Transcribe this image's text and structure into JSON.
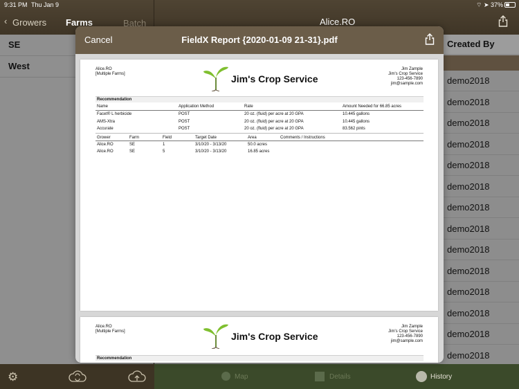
{
  "status": {
    "time": "9:31 PM",
    "date": "Thu Jan 9",
    "battery": "37%"
  },
  "left_nav": {
    "back": "Growers",
    "title": "Farms",
    "batch": "Batch"
  },
  "right_nav": {
    "title": "Alice.RO"
  },
  "left_list": [
    "SE",
    "West"
  ],
  "right_column": {
    "header": "Created By",
    "values": [
      "demo2018",
      "demo2018",
      "demo2018",
      "demo2018",
      "demo2018",
      "demo2018",
      "demo2018",
      "demo2018",
      "demo2018",
      "demo2018",
      "demo2018",
      "demo2018",
      "demo2018",
      "demo2018"
    ]
  },
  "bottom_tabs": {
    "map": "Map",
    "details": "Details",
    "history": "History"
  },
  "modal": {
    "cancel": "Cancel",
    "title": "FieldX Report {2020-01-09 21-31}.pdf"
  },
  "report": {
    "grower": "Alice.RO",
    "farms": "[Multiple Farms]",
    "brand": "Jim's Crop Service",
    "contact": [
      "Jim Zample",
      "Jim's Crop Service",
      "123-456-7890",
      "jim@sample.com"
    ],
    "recommendation_title": "Recommendation",
    "rec_headers": [
      "Name",
      "Application Method",
      "Rate",
      "Amount Needed for 66.85 acres"
    ],
    "rec_rows": [
      [
        "Facet® L herbicide",
        "POST",
        "20 oz. (fluid) per acre at 20 GPA",
        "10.445 gallons"
      ],
      [
        "AMS-Xtra",
        "POST",
        "20 oz. (fluid) per acre at 20 GPA",
        "10.445 gallons"
      ],
      [
        "Accurate",
        "POST",
        "20 oz. (fluid) per acre at 20 GPA",
        "83.562 pints"
      ]
    ],
    "field_headers": [
      "Grower",
      "Farm",
      "Field",
      "Target Date",
      "Area",
      "Comments / Instructions"
    ],
    "field_rows": [
      [
        "Alice.RO",
        "SE",
        "1",
        "3/10/20 - 3/13/20",
        "50.0 acres",
        ""
      ],
      [
        "Alice.RO",
        "SE",
        "5",
        "3/10/20 - 3/13/20",
        "16.85 acres",
        ""
      ]
    ]
  }
}
